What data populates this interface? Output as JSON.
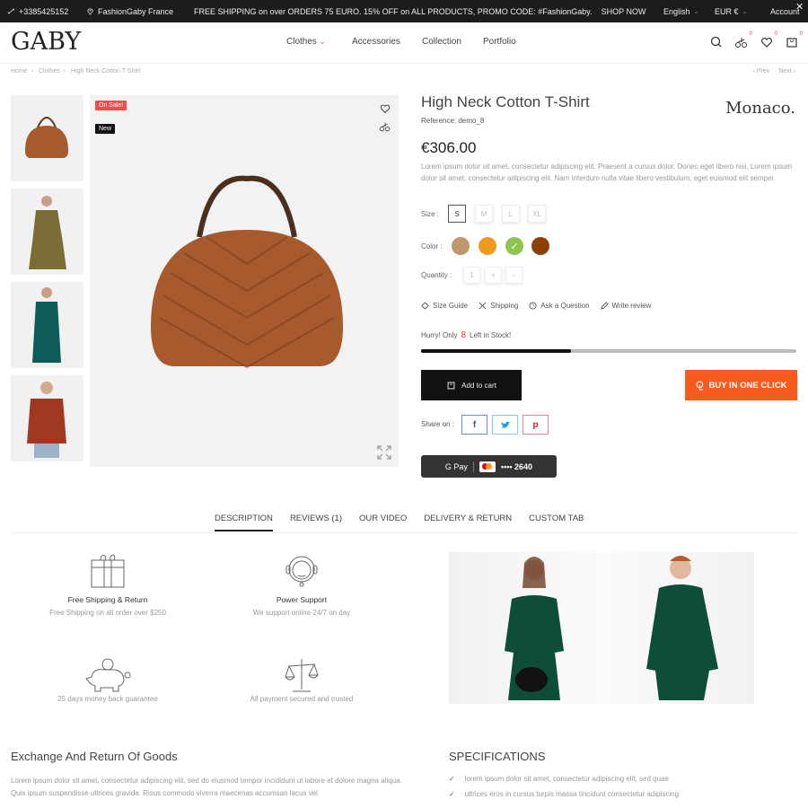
{
  "topbar": {
    "phone": "+3385425152",
    "location": "FashionGaby France",
    "promo": "FREE SHIPPING on over ORDERS 75 EURO. 15% OFF on ALL PRODUCTS, PROMO CODE: #FashionGaby.",
    "shop_now": "SHOP NOW",
    "language": "English",
    "currency": "EUR €",
    "account": "Account",
    "close": "✕"
  },
  "header": {
    "logo": "GABY",
    "nav": [
      "Clothes",
      "Accessories",
      "Collection",
      "Portfolio"
    ],
    "compare_count": "0",
    "wishlist_count": "0",
    "cart_count": "0"
  },
  "breadcrumb": [
    "Home",
    "Clothes",
    "High Neck Cotton T-Shirt"
  ],
  "pager": {
    "prev": "‹ Prev",
    "next": "Next ›"
  },
  "gallery": {
    "badges": {
      "sale": "On Sale!",
      "new": "New"
    },
    "thumbnails": [
      "handbag",
      "olive-dress",
      "teal-coat",
      "red-sweater"
    ]
  },
  "product": {
    "title": "High Neck Cotton T-Shirt",
    "reference": "Reference: demo_8",
    "brand": "Monaco.",
    "price": "€306.00",
    "description": "Lorem ipsum dolor sit amet, consectetur adipiscing elit. Praesent a cursus dolor. Donec eget libero nisi. Lorem ipsum dolor sit amet, consectetur adipiscing elit. Nam interdum nulla vitae libero vestibulum, eget euismod elit semper.",
    "size_label": "Size :",
    "sizes": [
      "S",
      "M",
      "L",
      "XL"
    ],
    "selected_size": "S",
    "color_label": "Color :",
    "colors": [
      "#c0976a",
      "#ef9a1f",
      "#8cc64f",
      "#8b4006"
    ],
    "selected_color": 2,
    "quantity_label": "Quantity :",
    "quantity": "1",
    "qty_plus": "+",
    "qty_minus": "-",
    "links": [
      "Size Guide",
      "Shipping",
      "Ask a Question",
      "Write review"
    ],
    "stock_prefix": "Hurry! Only",
    "stock_count": "8",
    "stock_suffix": "Left in Stock!",
    "stock_progress": 0.4,
    "add_to_cart": "Add to cart",
    "buy_one_click": "BUY IN ONE CLICK",
    "share_label": "Share on :",
    "share": [
      "f",
      "t",
      "p"
    ],
    "gpay": {
      "label": "G Pay",
      "card": "•••• 2640"
    }
  },
  "tabs": [
    "DESCRIPTION",
    "REVIEWS (1)",
    "OUR VIDEO",
    "DELIVERY & RETURN",
    "CUSTOM TAB"
  ],
  "active_tab": 0,
  "features": [
    {
      "title": "Free Shipping & Return",
      "sub": "Free Shipping on all order over $250"
    },
    {
      "title": "Power Support",
      "sub": "We support online 24/7 on day"
    },
    {
      "title": "",
      "sub": "25 days money back guarantee"
    },
    {
      "title": "",
      "sub": "All payment secured and trusted"
    }
  ],
  "exchange": {
    "title": "Exchange And Return Of Goods",
    "text": "Lorem ipsum dolor sit amet, consectetur adipiscing elit, sed do eiusmod tempor incididunt ut labore et dolore magna aliqua. Quis ipsum suspendisse ultrices gravida. Risus commodo viverra maecenas accumsan lacus vel"
  },
  "specifications": {
    "title": "SPECIFICATIONS",
    "items": [
      "lorem ipsum dolor sit amet, consectetur adipiscing elit, sed quae",
      "ultrices eros in cursus turpis massa tincidunt consectetur adipiscing"
    ]
  },
  "colors": {
    "accent": "#f75c1e",
    "sale_badge": "#f14b4b",
    "dark": "#111111"
  }
}
